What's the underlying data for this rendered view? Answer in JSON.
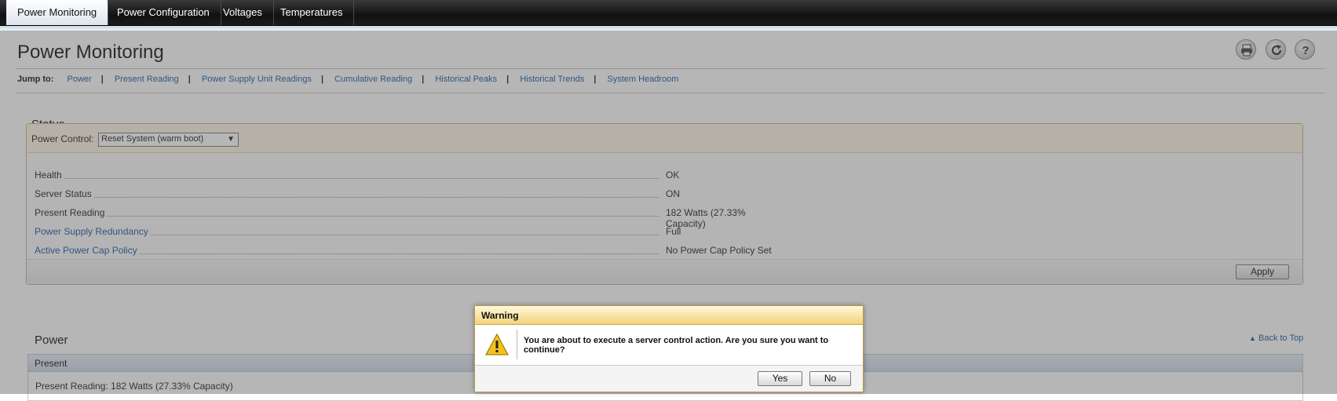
{
  "tabs": [
    {
      "label": "Power Monitoring",
      "active": true
    },
    {
      "label": "Power Configuration",
      "active": false
    },
    {
      "label": "Voltages",
      "active": false
    },
    {
      "label": "Temperatures",
      "active": false
    }
  ],
  "page": {
    "title": "Power Monitoring",
    "toolbar_icons": [
      "print-icon",
      "refresh-icon",
      "help-icon"
    ]
  },
  "jump": {
    "label": "Jump to:",
    "links": [
      "Power",
      "Present Reading",
      "Power Supply Unit Readings",
      "Cumulative Reading",
      "Historical Peaks",
      "Historical Trends",
      "System Headroom"
    ],
    "separator": "|"
  },
  "status": {
    "title": "Status",
    "power_control_label": "Power Control:",
    "power_control_value": "Reset System (warm boot)",
    "rows": [
      {
        "label": "Health",
        "value": "OK",
        "link": false
      },
      {
        "label": "Server Status",
        "value": "ON",
        "link": false
      },
      {
        "label": "Present Reading",
        "value": "182 Watts (27.33% Capacity)",
        "link": false
      },
      {
        "label": "Power Supply Redundancy",
        "value": "Full",
        "link": true
      },
      {
        "label": "Active Power Cap Policy",
        "value": "No Power Cap Policy Set",
        "link": true
      }
    ],
    "apply_label": "Apply"
  },
  "power": {
    "title": "Power",
    "back_to_top": "Back to Top",
    "present_header": "Present",
    "present_reading": "Present Reading: 182 Watts (27.33% Capacity)"
  },
  "dialog": {
    "title": "Warning",
    "message": "You are about to execute a server control action. Are you sure you want to continue?",
    "yes_label": "Yes",
    "no_label": "No"
  },
  "colors": {
    "link": "#1a5aa0",
    "tabbar": "#1b1b1b",
    "dialog_header": "#f3d27a"
  }
}
